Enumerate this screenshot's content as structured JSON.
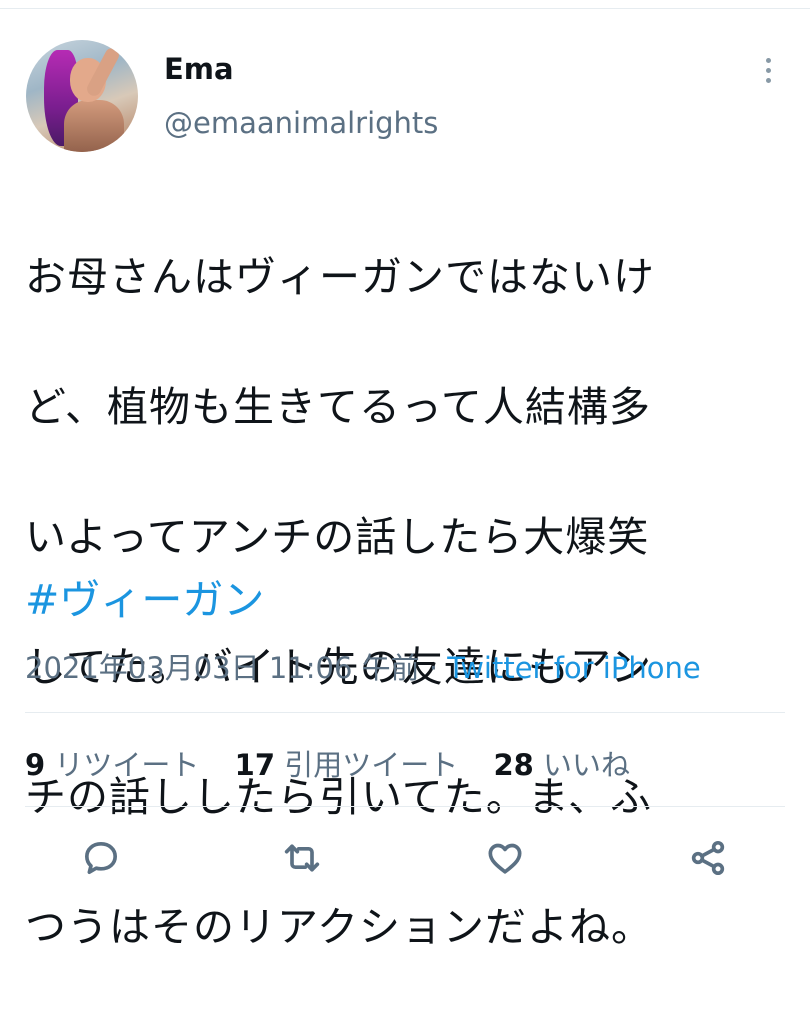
{
  "author": {
    "name": "Ema",
    "handle": "@emaanimalrights"
  },
  "tweet": {
    "text_lines": [
      "お母さんはヴィーガンではないけ",
      "ど、植物も生きてるって人結構多",
      "いよってアンチの話したら大爆笑",
      "してた。バイト先の友達にもアン",
      "チの話ししたら引いてた。ま、ふ",
      "つうはそのリアクションだよね。"
    ],
    "hashtag": "#ヴィーガン",
    "timestamp": "2021年03月03日 11:06 午前",
    "separator": " · ",
    "source": "Twitter for iPhone"
  },
  "stats": {
    "retweets_count": "9",
    "retweets_label": "リツイート",
    "quotes_count": "17",
    "quotes_label": "引用ツイート",
    "likes_count": "28",
    "likes_label": "いいね"
  },
  "icons": {
    "more": "more-vertical-icon",
    "reply": "reply-icon",
    "retweet": "retweet-icon",
    "like": "heart-icon",
    "share": "share-icon"
  },
  "colors": {
    "text": "#0f1419",
    "secondary": "#5b7083",
    "link": "#1b95e0",
    "divider": "#e6ecf0"
  }
}
